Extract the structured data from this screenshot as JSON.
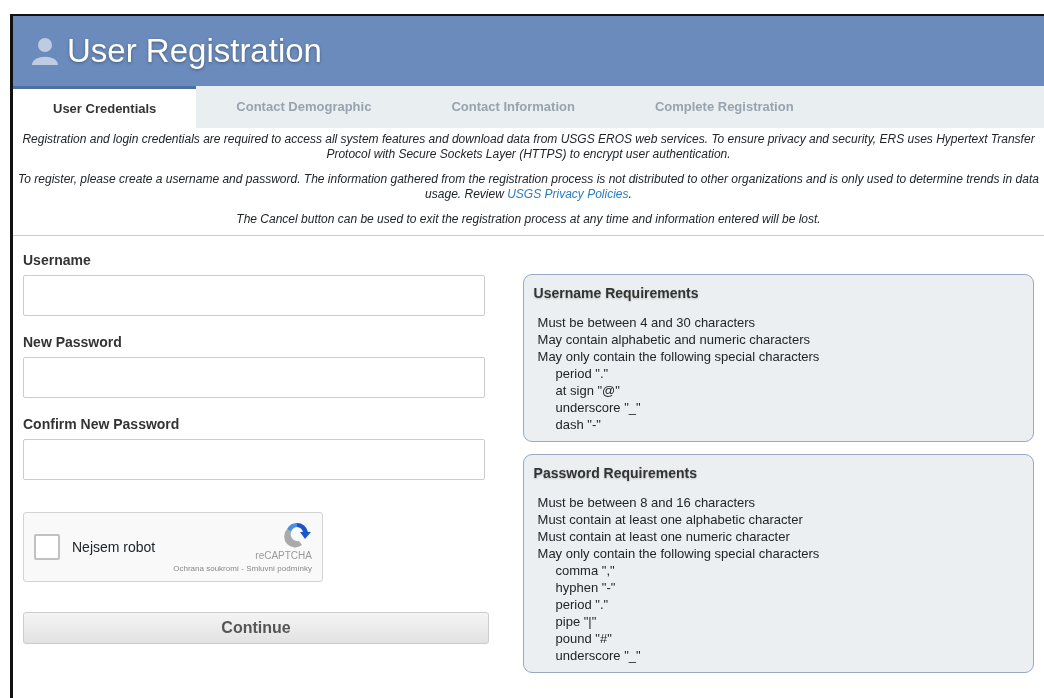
{
  "header": {
    "title": "User Registration"
  },
  "tabs": [
    {
      "label": "User Credentials",
      "selected": true
    },
    {
      "label": "Contact Demographic",
      "selected": false
    },
    {
      "label": "Contact Information",
      "selected": false
    },
    {
      "label": "Complete Registration",
      "selected": false
    }
  ],
  "intro": [
    {
      "text": "Registration and login credentials are required to access all system features and download data from USGS EROS web services. To ensure privacy and security, ERS uses Hypertext Transfer Protocol with Secure Sockets Layer (HTTPS) to encrypt user authentication."
    },
    {
      "text": "To register, please create a username and password. The information gathered from the registration process is not distributed to other organizations and is only used to determine trends in data usage. Review ",
      "link": "USGS Privacy Policies",
      "after": "."
    },
    {
      "text": "The Cancel button can be used to exit the registration process at any time and information entered will be lost."
    }
  ],
  "fields": [
    {
      "label": "Username"
    },
    {
      "label": "New Password"
    },
    {
      "label": "Confirm New Password"
    }
  ],
  "captcha": {
    "label": "Nejsem robot",
    "checked": false,
    "brand": "reCAPTCHA",
    "footer": "Ochrana soukromí - Smluvní podmínky"
  },
  "continue_button": "Continue",
  "requirements": [
    {
      "title": "Username Requirements",
      "items": [
        {
          "text": "Must be between 4 and 30 characters"
        },
        {
          "text": "May contain alphabetic and numeric characters"
        },
        {
          "text": "May only contain the following special characters",
          "children": [
            {
              "text": "period \".\""
            },
            {
              "text": "at sign \"@\""
            },
            {
              "text": "underscore \"_\""
            },
            {
              "text": "dash \"-\""
            }
          ]
        }
      ]
    },
    {
      "title": "Password Requirements",
      "items": [
        {
          "text": "Must be between 8 and 16 characters"
        },
        {
          "text": "Must contain at least one alphabetic character"
        },
        {
          "text": "Must contain at least one numeric character"
        },
        {
          "text": "May only contain the following special characters",
          "children": [
            {
              "text": "comma \",\""
            },
            {
              "text": "hyphen \"-\""
            },
            {
              "text": "period \".\""
            },
            {
              "text": "pipe \"|\""
            },
            {
              "text": "pound \"#\""
            },
            {
              "text": "underscore \"_\""
            }
          ]
        }
      ]
    }
  ]
}
